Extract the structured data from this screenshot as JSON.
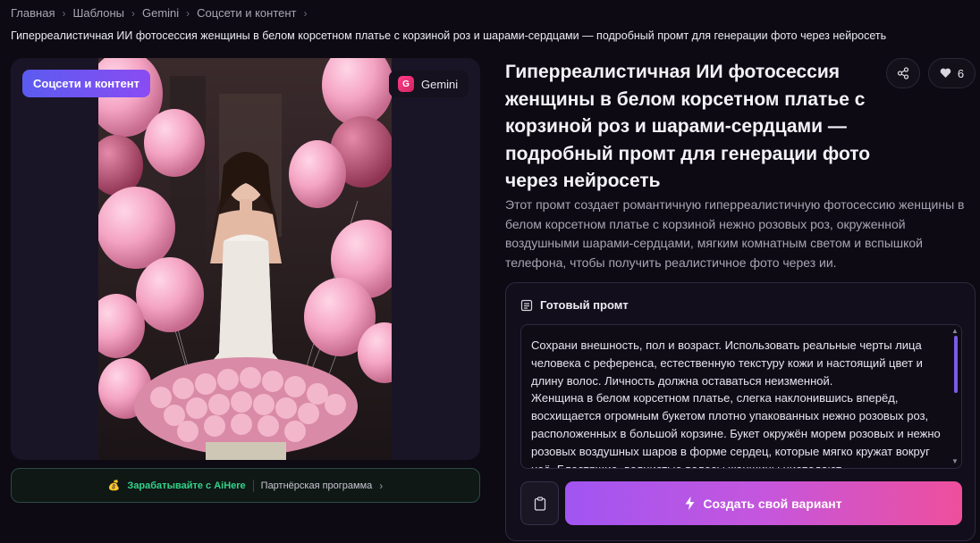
{
  "breadcrumb": [
    {
      "label": "Главная"
    },
    {
      "label": "Шаблоны"
    },
    {
      "label": "Gemini"
    },
    {
      "label": "Соцсети и контент"
    }
  ],
  "subtitle": "Гиперреалистичная ИИ фотосессия женщины в белом корсетном платье с корзиной роз и шарами-сердцами — подробный промт для генерации фото через нейросеть",
  "media": {
    "category_badge": "Соцсети и контент",
    "model_badge": {
      "logo_letter": "G",
      "label": "Gemini"
    }
  },
  "partner": {
    "icon": "money-bag-icon",
    "earn_label": "Зарабатывайте с AiHere",
    "program_label": "Партнёрская программа"
  },
  "title": "Гиперреалистичная ИИ фотосессия женщины в белом корсетном платье с корзиной роз и шарами-сердцами — подробный промт для генерации фото через нейросеть",
  "actions": {
    "like_count": "6"
  },
  "description": "Этот промт создает романтичную гиперреалистичную фотосессию женщины в белом корсетном платье с корзиной нежно розовых роз, окруженной воздушными шарами-сердцами, мягким комнатным светом и вспышкой телефона, чтобы получить реалистичное фото через ии.",
  "prompt": {
    "heading": "Готовый промт",
    "text": "Сохрани внешность, пол и возраст. Использовать реальные черты лица человека с референса, естественную текстуру кожи и настоящий цвет и длину волос. Личность должна оставаться неизменной.\nЖенщина в белом корсетном платье, слегка наклонившись вперёд, восхищается огромным букетом плотно упакованных нежно розовых роз, расположенных в большой корзине. Букет окружён морем розовых и нежно розовых воздушных шаров в форме сердец, которые мягко кружат вокруг неё. Блестящие, волнистые волосы женщины ниспадают",
    "create_label": "Создать свой вариант"
  },
  "colors": {
    "accent_purple": "#8a4cf2",
    "accent_pink": "#ee4f9c",
    "green": "#34d28a",
    "background": "#0d0a14"
  }
}
